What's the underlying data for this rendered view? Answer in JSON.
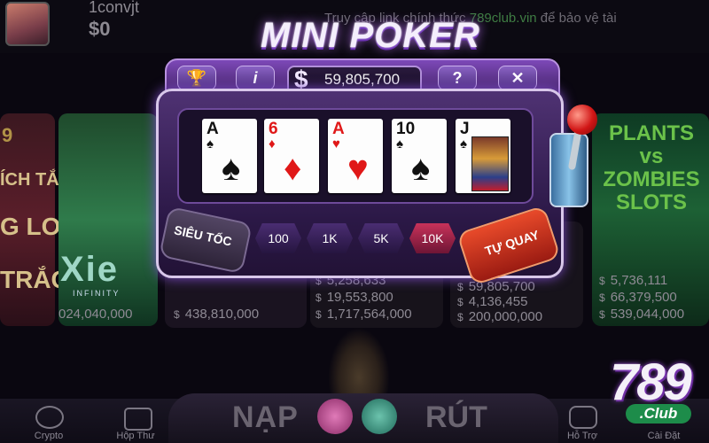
{
  "header": {
    "username": "1convjt",
    "balance": "$0",
    "marquee_prefix": "Truy cập link chính thức",
    "marquee_site": "789club.vin",
    "marquee_suffix": "để bảo vệ tài"
  },
  "lobby": {
    "left_card_text": [
      "9",
      "ÍCH TẮC",
      "G LO",
      "TRẮC"
    ],
    "axie_word": "Xie",
    "axie_sub": "INFINITY",
    "pvz_title": "PLANTS vs ZOMBIES SLOTS",
    "prices": {
      "axie": "024,040,000",
      "dark": "438,810,000",
      "mid1": [
        "5,258,633",
        "19,553,800",
        "1,717,564,000"
      ],
      "mid2": [
        "59,805,700",
        "4,136,455",
        "200,000,000"
      ],
      "pvz": [
        "5,736,111",
        "66,379,500",
        "539,044,000"
      ]
    },
    "currency_symbol": "$"
  },
  "mini_poker": {
    "title": "MINI POKER",
    "trophy_icon": "trophy-icon",
    "info_label": "i",
    "jackpot_symbol": "$",
    "jackpot_value": "59,805,700",
    "help_label": "?",
    "close_label": "✕",
    "cards": [
      {
        "rank": "A",
        "suit": "♠",
        "color": "black",
        "face": false
      },
      {
        "rank": "6",
        "suit": "♦",
        "color": "red",
        "face": false
      },
      {
        "rank": "A",
        "suit": "♥",
        "color": "red",
        "face": false
      },
      {
        "rank": "10",
        "suit": "♠",
        "color": "black",
        "face": false
      },
      {
        "rank": "J",
        "suit": "♠",
        "color": "black",
        "face": true
      }
    ],
    "speed_label": "SIÊU TỐC",
    "bets": [
      {
        "label": "100",
        "active": false
      },
      {
        "label": "1K",
        "active": false
      },
      {
        "label": "5K",
        "active": false
      },
      {
        "label": "10K",
        "active": true
      }
    ],
    "spin_label": "TỰ QUAY"
  },
  "bottom_nav": {
    "crypto": "Crypto",
    "inbox": "Hộp Thư",
    "deposit": "NẠP",
    "withdraw": "RÚT",
    "support": "Hỗ Trợ",
    "settings": "Cài Đặt"
  },
  "brand": {
    "logo_number": "789",
    "logo_club": ".Club"
  },
  "colors": {
    "accent_purple": "#7d49b8",
    "active_bet": "#c8325a",
    "spin_orange": "#e84a2a",
    "site_green": "#3f7d43"
  }
}
